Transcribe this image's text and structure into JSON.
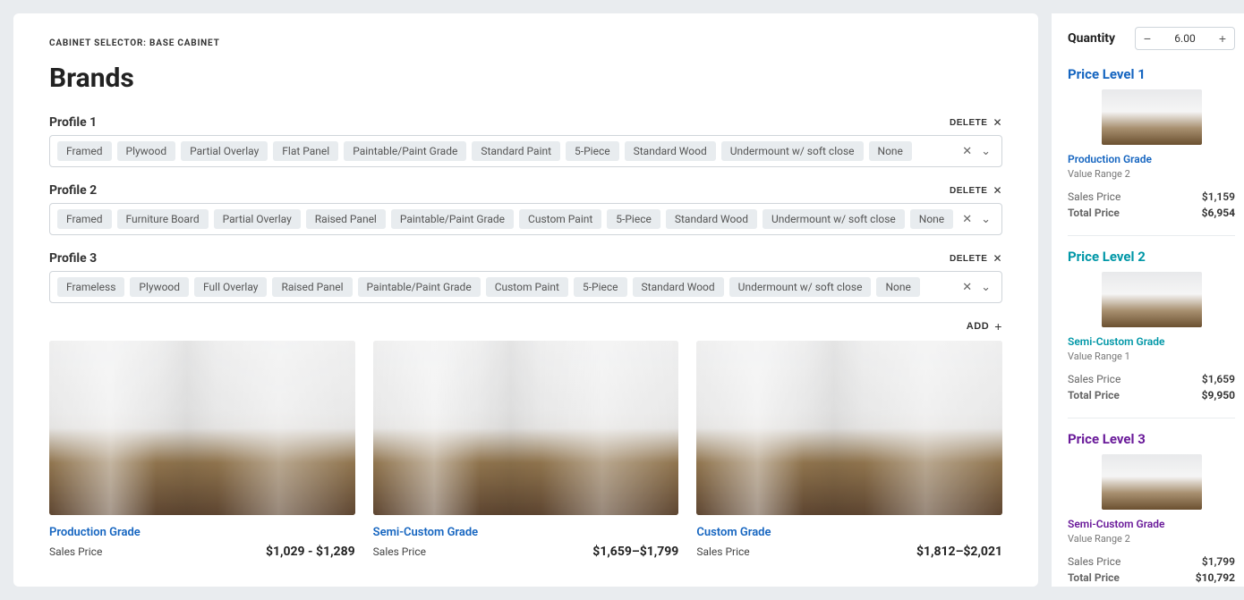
{
  "breadcrumb": "CABINET SELECTOR: BASE CABINET",
  "page_title": "Brands",
  "actions": {
    "delete": "DELETE",
    "add": "ADD"
  },
  "profiles": [
    {
      "title": "Profile 1",
      "chips": [
        "Framed",
        "Plywood",
        "Partial Overlay",
        "Flat Panel",
        "Paintable/Paint Grade",
        "Standard Paint",
        "5-Piece",
        "Standard Wood",
        "Undermount w/ soft close",
        "None"
      ]
    },
    {
      "title": "Profile 2",
      "chips": [
        "Framed",
        "Furniture Board",
        "Partial Overlay",
        "Raised Panel",
        "Paintable/Paint Grade",
        "Custom Paint",
        "5-Piece",
        "Standard Wood",
        "Undermount w/ soft close",
        "None"
      ]
    },
    {
      "title": "Profile 3",
      "chips": [
        "Frameless",
        "Plywood",
        "Full Overlay",
        "Raised Panel",
        "Paintable/Paint Grade",
        "Custom Paint",
        "5-Piece",
        "Standard Wood",
        "Undermount w/ soft close",
        "None"
      ]
    }
  ],
  "grades": [
    {
      "name": "Production Grade",
      "price_label": "Sales Price",
      "price_value": "$1,029 - $1,289"
    },
    {
      "name": "Semi-Custom Grade",
      "price_label": "Sales Price",
      "price_value": "$1,659–$1,799"
    },
    {
      "name": "Custom Grade",
      "price_label": "Sales Price",
      "price_value": "$1,812–$2,021"
    }
  ],
  "sidebar": {
    "qty_label": "Quantity",
    "qty_value": "6.00",
    "levels": [
      {
        "title": "Price Level 1",
        "grade": "Production Grade",
        "range": "Value Range 2",
        "sales_lbl": "Sales Price",
        "sales": "$1,159",
        "total_lbl": "Total Price",
        "total": "$6,954"
      },
      {
        "title": "Price Level 2",
        "grade": "Semi-Custom Grade",
        "range": "Value Range 1",
        "sales_lbl": "Sales Price",
        "sales": "$1,659",
        "total_lbl": "Total Price",
        "total": "$9,950"
      },
      {
        "title": "Price Level 3",
        "grade": "Semi-Custom Grade",
        "range": "Value Range 2",
        "sales_lbl": "Sales Price",
        "sales": "$1,799",
        "total_lbl": "Total Price",
        "total": "$10,792"
      }
    ]
  },
  "colors": {
    "blue": "#1565c0",
    "teal": "#0097a7",
    "purple": "#6a1b9a"
  }
}
